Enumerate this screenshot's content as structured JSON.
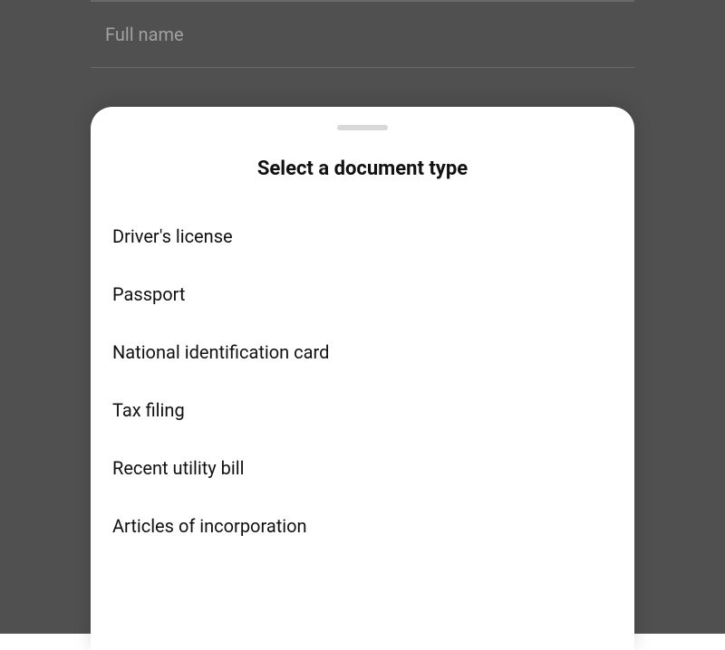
{
  "form": {
    "full_name_placeholder": "Full name"
  },
  "sheet": {
    "title": "Select a document type",
    "options": [
      "Driver's license",
      "Passport",
      "National identification card",
      "Tax filing",
      "Recent utility bill",
      "Articles of incorporation"
    ]
  }
}
